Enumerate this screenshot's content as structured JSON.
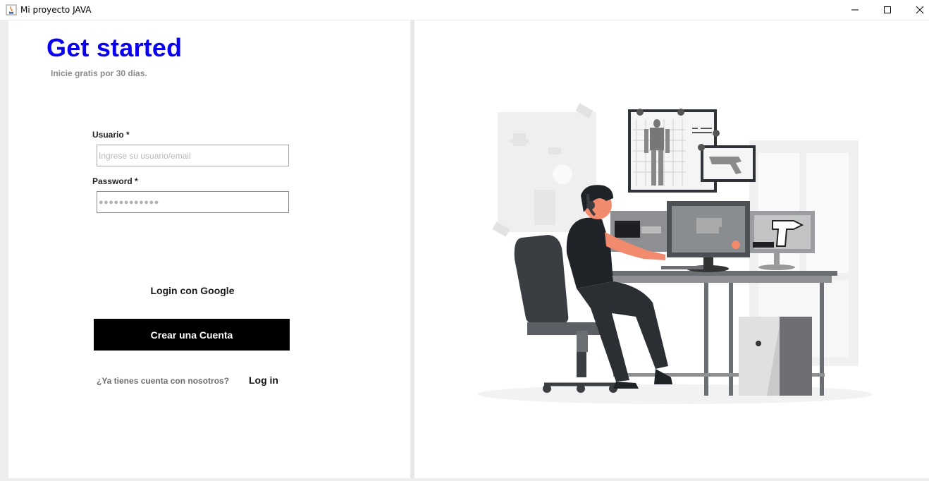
{
  "window": {
    "title": "Mi proyecto JAVA",
    "controls": [
      "minimize-icon",
      "maximize-icon",
      "close-icon"
    ]
  },
  "form": {
    "heading": "Get started",
    "subheading": "Inicie gratis por 30 dias.",
    "username_label": "Usuario *",
    "username_placeholder": "Ingrese su usuario/email",
    "password_label": "Password *",
    "password_value": "●●●●●●●●●●●●",
    "google_button": "Login con Google",
    "create_button": "Crear una Cuenta",
    "already_text": "¿Ya tienes cuenta con nosotros?",
    "login_link": "Log in"
  },
  "colors": {
    "heading": "#0b00ee",
    "primary_button": "#000000"
  }
}
